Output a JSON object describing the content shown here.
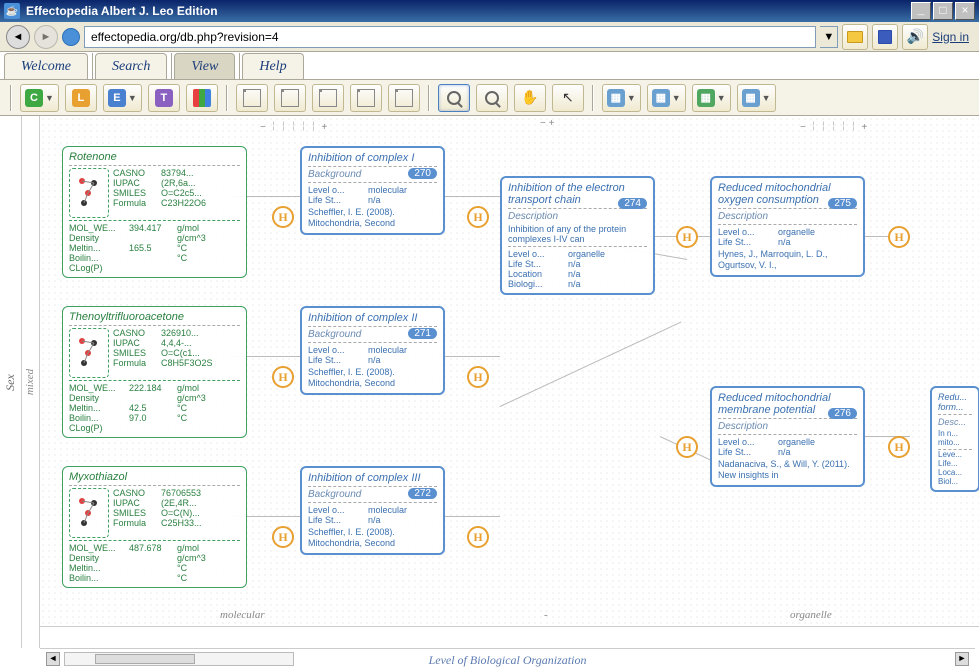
{
  "window": {
    "title": "Effectopedia  Albert J. Leo Edition"
  },
  "addr": {
    "url": "effectopedia.org/db.php?revision=4",
    "signin": "Sign in"
  },
  "tabs": [
    "Welcome",
    "Search",
    "View",
    "Help"
  ],
  "toolbar": {
    "c": "C",
    "l": "L",
    "e": "E",
    "t": "T"
  },
  "canvas": {
    "yaxis": "Sex",
    "yaxis2": "mixed",
    "xaxis": "Level of Biological Organization",
    "xlabel1": "molecular",
    "xlabel2": "-",
    "xlabel3": "organelle",
    "ruler1": "−  ￤￤￤￤￤  +",
    "ruler2": "−  +",
    "ruler3": "−  ￤￤￤￤￤  +"
  },
  "chems": [
    {
      "title": "Rotenone",
      "props": [
        [
          "CASNO",
          "83794..."
        ],
        [
          "IUPAC",
          "(2R,6a..."
        ],
        [
          "SMILES",
          "O=C2c5..."
        ],
        [
          "Formula",
          "C23H22O6"
        ]
      ],
      "bottom": [
        [
          "MOL_WE...",
          "394.417",
          "g/mol"
        ],
        [
          "Density",
          "",
          "g/cm^3"
        ],
        [
          "Meltin...",
          "165.5",
          "°C"
        ],
        [
          "Boilin...",
          "",
          "°C"
        ],
        [
          "CLog(P)",
          "",
          ""
        ]
      ]
    },
    {
      "title": "Thenoyltrifluoroacetone",
      "props": [
        [
          "CASNO",
          "326910..."
        ],
        [
          "IUPAC",
          "4,4,4-..."
        ],
        [
          "SMILES",
          "O=C(c1..."
        ],
        [
          "Formula",
          "C8H5F3O2S"
        ]
      ],
      "bottom": [
        [
          "MOL_WE...",
          "222.184",
          "g/mol"
        ],
        [
          "Density",
          "",
          "g/cm^3"
        ],
        [
          "Meltin...",
          "42.5",
          "°C"
        ],
        [
          "Boilin...",
          "97.0",
          "°C"
        ],
        [
          "CLog(P)",
          "",
          ""
        ]
      ]
    },
    {
      "title": "Myxothiazol",
      "props": [
        [
          "CASNO",
          "76706553"
        ],
        [
          "IUPAC",
          "(2E,4R..."
        ],
        [
          "SMILES",
          "O=C(N)..."
        ],
        [
          "Formula",
          "C25H33..."
        ]
      ],
      "bottom": [
        [
          "MOL_WE...",
          "487.678",
          "g/mol"
        ],
        [
          "Density",
          "",
          "g/cm^3"
        ],
        [
          "Meltin...",
          "",
          "°C"
        ],
        [
          "Boilin...",
          "",
          "°C"
        ]
      ]
    }
  ],
  "inhib": [
    {
      "title": "Inhibition of complex I",
      "badge": "270",
      "sub": "Background",
      "rows": [
        [
          "Level o...",
          "molecular"
        ],
        [
          "Life St...",
          "n/a"
        ]
      ],
      "ref": "Scheffler, I. E. (2008). Mitochondria, Second"
    },
    {
      "title": "Inhibition of complex II",
      "badge": "271",
      "sub": "Background",
      "rows": [
        [
          "Level o...",
          "molecular"
        ],
        [
          "Life St...",
          "n/a"
        ]
      ],
      "ref": "Scheffler, I. E. (2008). Mitochondria, Second"
    },
    {
      "title": "Inhibition of complex III",
      "badge": "272",
      "sub": "Background",
      "rows": [
        [
          "Level o...",
          "molecular"
        ],
        [
          "Life St...",
          "n/a"
        ]
      ],
      "ref": "Scheffler, I. E. (2008). Mitochondria, Second"
    }
  ],
  "mid": {
    "title": "Inhibition of the electron transport chain",
    "badge": "274",
    "sub": "Description",
    "desc": "Inhibition of any of the protein complexes I-IV can",
    "rows": [
      [
        "Level o...",
        "organelle"
      ],
      [
        "Life St...",
        "n/a"
      ],
      [
        "Location",
        "n/a"
      ],
      [
        "Biologi...",
        "n/a"
      ]
    ]
  },
  "right": [
    {
      "title": "Reduced mitochondrial oxygen consumption",
      "badge": "275",
      "sub": "Description",
      "rows": [
        [
          "Level o...",
          "organelle"
        ],
        [
          "Life St...",
          "n/a"
        ]
      ],
      "ref": "Hynes, J., Marroquin, L. D., Ogurtsov, V. I.,"
    },
    {
      "title": "Reduced mitochondrial membrane potential",
      "badge": "276",
      "sub": "Description",
      "rows": [
        [
          "Level o...",
          "organelle"
        ],
        [
          "Life St...",
          "n/a"
        ]
      ],
      "ref": "Nadanaciva, S., & Will, Y. (2011). New insights in"
    }
  ],
  "far": {
    "title": "Redu... form...",
    "sub": "Desc...",
    "desc": "In n... mito...",
    "rows": [
      [
        "Leve...",
        ""
      ],
      [
        "Life...",
        ""
      ],
      [
        "Loca...",
        ""
      ],
      [
        "Biol...",
        ""
      ]
    ]
  }
}
